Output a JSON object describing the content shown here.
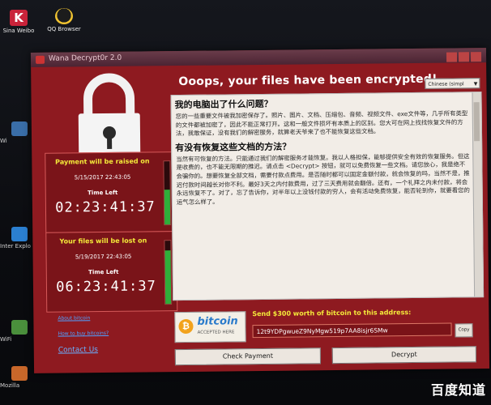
{
  "desktop": {
    "icons": [
      {
        "label": "Sina Weibo",
        "icon": "sina-icon"
      },
      {
        "label": "QQ Browser",
        "icon": "qq-icon"
      }
    ],
    "side_icons": [
      "Wi",
      "Inter Explo",
      "WiFi",
      "Mozilla"
    ]
  },
  "window": {
    "title": "Wana Decrypt0r 2.0",
    "heading": "Ooops, your files have been encrypted!",
    "language": "Chinese (simpl"
  },
  "timers": [
    {
      "label": "Payment will be raised on",
      "date": "5/15/2017 22:43:05",
      "time_left_label": "Time Left",
      "clock": "02:23:41:37",
      "bar_fill": 0.55,
      "bar_color": "#2fae3a"
    },
    {
      "label": "Your files will be lost on",
      "date": "5/19/2017 22:43:05",
      "time_left_label": "Time Left",
      "clock": "06:23:41:37",
      "bar_fill": 0.85,
      "bar_color": "#2fae3a"
    }
  ],
  "links": {
    "about": "About bitcoin",
    "how_to_buy": "How to buy bitcoins?",
    "contact": "Contact Us"
  },
  "panel": {
    "h1": "我的电脑出了什么问题？",
    "p1": "您的一些重要文件被我加密保存了。照片、图片、文档、压缩包、音频、视频文件、exe文件等，几乎所有类型的文件都被加密了，因此不能正常打开。这和一般文件损坏有本质上的区别。您大可在网上找找恢复文件的方法，我敢保证，没有我们的解密服务，就算老天爷来了也不能恢复这些文档。",
    "h2": "有没有恢复这些文档的方法？",
    "p2": "当然有可恢复的方法。只能通过我们的解密服务才能恢复。我以人格担保，能够提供安全有效的恢复服务。但这是收费的，也不能无限期的推迟。请点击 <Decrypt> 按钮，就可以免费恢复一些文档。请您放心，我是绝不会骗你的。想要恢复全部文档，需要付款点费用。是否随时都可以固定金额付款，就会恢复的吗，当然不是，推迟付款时间越长对你不利。最好3天之内付款费用，过了三天费用就会翻倍。还有，一个礼拜之内未付款，将会永远恢复不了。对了，忘了告诉你，对半年以上没钱付款的穷人，会有活动免费恢复，能否轮到你，就要看您的运气怎么样了。"
  },
  "payment": {
    "logo_word": "bitcoin",
    "logo_sub": "ACCEPTED HERE",
    "send_text": "Send $300 worth of bitcoin to this address:",
    "address": "12t9YDPgwueZ9NyMgw519p7AA8isjr6SMw",
    "copy_label": "Copy",
    "check_label": "Check Payment",
    "decrypt_label": "Decrypt"
  },
  "watermark": "百度知道"
}
